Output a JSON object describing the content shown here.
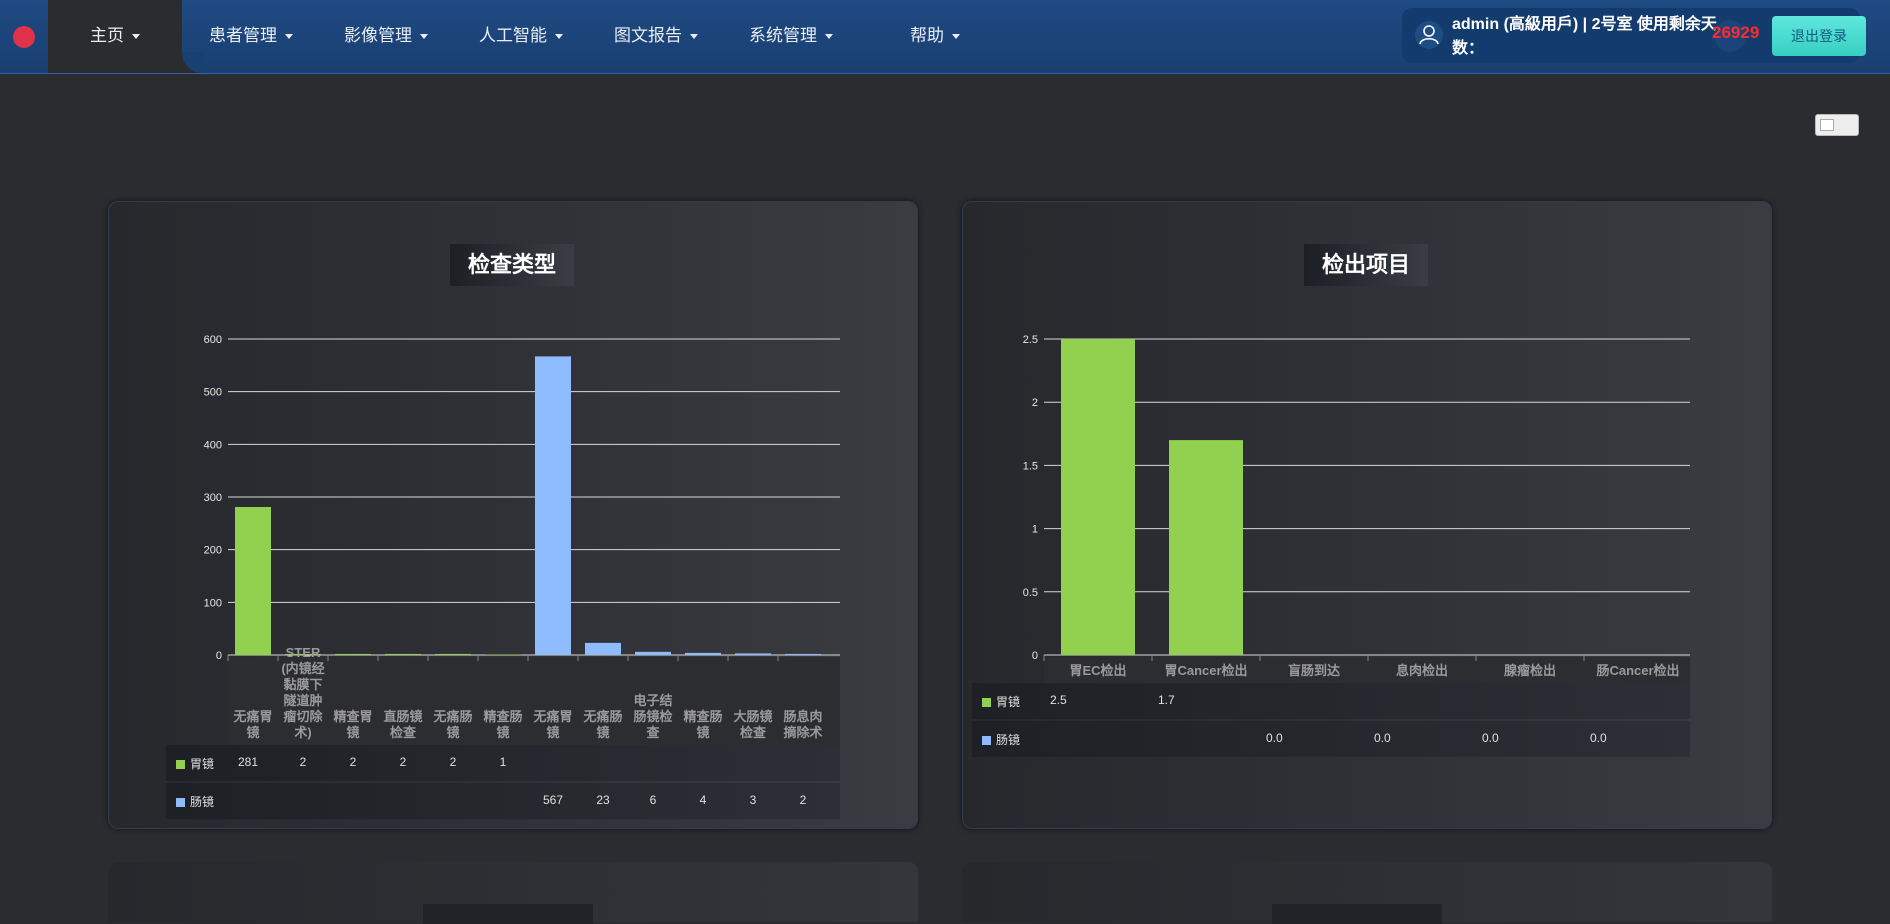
{
  "nav": {
    "items": [
      {
        "label": "主页"
      },
      {
        "label": "患者管理"
      },
      {
        "label": "影像管理"
      },
      {
        "label": "人工智能"
      },
      {
        "label": "图文报告"
      },
      {
        "label": "系统管理"
      },
      {
        "label": "帮助"
      }
    ],
    "active_index": 0,
    "user": {
      "text": "admin (高級用戶) | 2号室 使用剩余天数：",
      "days_remaining": "26929"
    },
    "logout_label": "退出登录",
    "colors": {
      "accent": "#1a3f72",
      "logout": "#38cfc3",
      "days": "#ff2a2a"
    }
  },
  "panels": [
    {
      "title": "检查类型",
      "chart_data": {
        "type": "bar",
        "ylim": [
          0,
          600
        ],
        "yticks": [
          0,
          100,
          200,
          300,
          400,
          500,
          600
        ],
        "categories": [
          "无痛胃镜",
          "STER(内镜经黏膜下隧道肿瘤切除术)",
          "精查胃镜",
          "直肠镜检查",
          "无痛肠镜",
          "精查肠镜",
          "无痛胃镜",
          "无痛肠镜",
          "电子结肠镜检查",
          "精查肠镜",
          "大肠镜检查",
          "肠息肉摘除术"
        ],
        "series": [
          {
            "name": "胃镜",
            "color": "#92d050",
            "values": [
              281,
              2,
              2,
              2,
              2,
              1,
              null,
              null,
              null,
              null,
              null,
              null
            ]
          },
          {
            "name": "肠镜",
            "color": "#8fbcff",
            "values": [
              null,
              null,
              null,
              null,
              null,
              null,
              567,
              23,
              6,
              4,
              3,
              2
            ]
          }
        ]
      }
    },
    {
      "title": "检出项目",
      "chart_data": {
        "type": "bar",
        "ylim": [
          0,
          2.5
        ],
        "yticks": [
          0,
          0.5,
          1,
          1.5,
          2,
          2.5
        ],
        "categories": [
          "胃EC检出",
          "胃Cancer检出",
          "盲肠到达",
          "息肉检出",
          "腺瘤检出",
          "肠Cancer检出"
        ],
        "series": [
          {
            "name": "胃镜",
            "color": "#92d050",
            "values": [
              2.5,
              1.7,
              null,
              null,
              null,
              null
            ],
            "display": [
              "2.5",
              "1.7",
              "",
              "",
              "",
              ""
            ]
          },
          {
            "name": "肠镜",
            "color": "#8fbcff",
            "values": [
              null,
              null,
              0,
              0,
              0,
              0
            ],
            "display": [
              "",
              "",
              "0.0",
              "0.0",
              "0.0",
              "0.0"
            ]
          }
        ]
      }
    }
  ]
}
